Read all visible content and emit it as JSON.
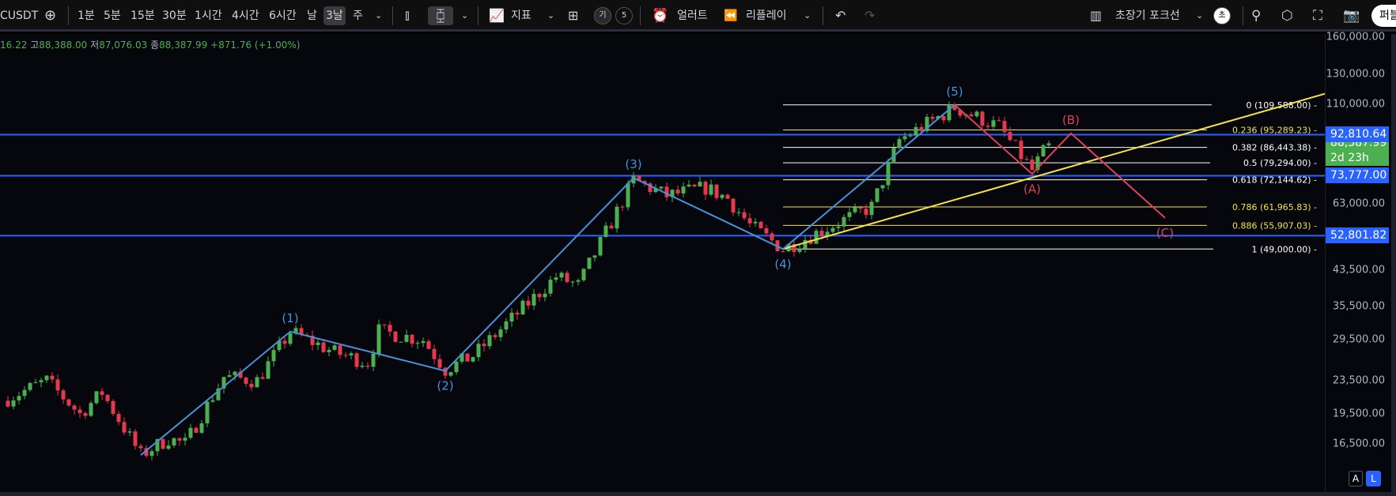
{
  "toolbar": {
    "symbol": "CUSDT",
    "intervals": [
      "1분",
      "5분",
      "15분",
      "30분",
      "1시간",
      "4시간",
      "6시간",
      "날",
      "3날",
      "주"
    ],
    "active_interval": "3날",
    "indicators_label": "지표",
    "layout_badges": [
      "기",
      "5"
    ],
    "alert_label": "얼러트",
    "replay_label": "리플레이",
    "layout_name": "초장기 포크선",
    "layout_badge": "초",
    "publish_label": "퍼블"
  },
  "legend": {
    "prefix": "16.22",
    "high_label": "고",
    "high": "88,388.00",
    "low_label": "저",
    "low": "87,076.03",
    "close_label": "종",
    "close": "88,387.99",
    "change": "+871.76 (+1.00%)"
  },
  "colors": {
    "up": "#4caf50",
    "down": "#e53950",
    "wave": "#4a90d9",
    "correction": "#e0405a",
    "trend": "#f5e14a",
    "hline": "#2962ff",
    "badge_green": "#4caf50"
  },
  "chart_data": {
    "type": "candlestick",
    "scale": "log",
    "ylim": [
      15000,
      165000
    ],
    "y_ticks": [
      "160,000.00",
      "130,000.00",
      "110,000.00",
      "63,000.00",
      "43,500.00",
      "35,500.00",
      "29,500.00",
      "23,500.00",
      "19,500.00",
      "16,500.00"
    ],
    "y_tick_values": [
      160000,
      130000,
      110000,
      63000,
      43500,
      35500,
      29500,
      23500,
      19500,
      16500
    ],
    "price_path": [
      [
        0,
        21000
      ],
      [
        8,
        23500
      ],
      [
        14,
        19500
      ],
      [
        18,
        22000
      ],
      [
        25,
        15500
      ],
      [
        30,
        17000
      ],
      [
        33,
        16500
      ],
      [
        40,
        24000
      ],
      [
        46,
        23500
      ],
      [
        52,
        30900
      ],
      [
        60,
        27500
      ],
      [
        66,
        26000
      ],
      [
        68,
        31000
      ],
      [
        76,
        29500
      ],
      [
        80,
        25000
      ],
      [
        85,
        27000
      ],
      [
        100,
        42000
      ],
      [
        104,
        40000
      ],
      [
        114,
        72000
      ],
      [
        120,
        66000
      ],
      [
        127,
        69000
      ],
      [
        131,
        65000
      ],
      [
        135,
        56000
      ],
      [
        141,
        49000
      ],
      [
        150,
        56000
      ],
      [
        157,
        62000
      ],
      [
        162,
        90000
      ],
      [
        172,
        108000
      ],
      [
        180,
        97000
      ],
      [
        186,
        76000
      ],
      [
        189,
        88388
      ]
    ],
    "elliott_waves": [
      {
        "label": "",
        "bar": 25,
        "price": 15500
      },
      {
        "label": "(1)",
        "bar": 52,
        "price": 30900
      },
      {
        "label": "(2)",
        "bar": 80,
        "price": 24800
      },
      {
        "label": "(3)",
        "bar": 114,
        "price": 72900
      },
      {
        "label": "(4)",
        "bar": 141,
        "price": 49000
      },
      {
        "label": "(5)",
        "bar": 172,
        "price": 109588
      }
    ],
    "correction_waves": [
      {
        "label": "(A)",
        "bar": 186,
        "price": 74500
      },
      {
        "label": "(B)",
        "bar": 193,
        "price": 93500
      },
      {
        "label": "(C)",
        "bar": 210,
        "price": 58300
      }
    ],
    "fib_retracement": {
      "from_bar": 141,
      "levels": [
        {
          "ratio": "0",
          "price": 109588,
          "label": "0 (109,588.00)",
          "color": "#ffffff"
        },
        {
          "ratio": "0.236",
          "price": 95289.23,
          "label": "0.236 (95,289.23)",
          "color": "#f5e14a"
        },
        {
          "ratio": "0.382",
          "price": 86443.38,
          "label": "0.382 (86,443.38)",
          "color": "#ffffff"
        },
        {
          "ratio": "0.5",
          "price": 79294,
          "label": "0.5 (79,294.00)",
          "color": "#ffffff"
        },
        {
          "ratio": "0.618",
          "price": 72144.62,
          "label": "0.618 (72,144.62)",
          "color": "#ffffff"
        },
        {
          "ratio": "0.786",
          "price": 61965.83,
          "label": "0.786 (61,965.83)",
          "color": "#f5e14a"
        },
        {
          "ratio": "0.886",
          "price": 55907.03,
          "label": "0.886 (55,907.03)",
          "color": "#f5e14a"
        },
        {
          "ratio": "1",
          "price": 49000,
          "label": "1 (49,000.00)",
          "color": "#ffffff"
        }
      ]
    },
    "trendline": [
      [
        141,
        49000
      ],
      [
        186,
        73000
      ]
    ],
    "horizontal_lines": [
      {
        "price": 92810.64,
        "label": "92,810.64"
      },
      {
        "price": 73777,
        "label": "73,777.00"
      },
      {
        "price": 52801.82,
        "label": "52,801.82"
      }
    ],
    "last_price": {
      "value": "88,387.99",
      "countdown": "2d 23h"
    }
  },
  "axis_buttons": [
    "A",
    "L"
  ]
}
